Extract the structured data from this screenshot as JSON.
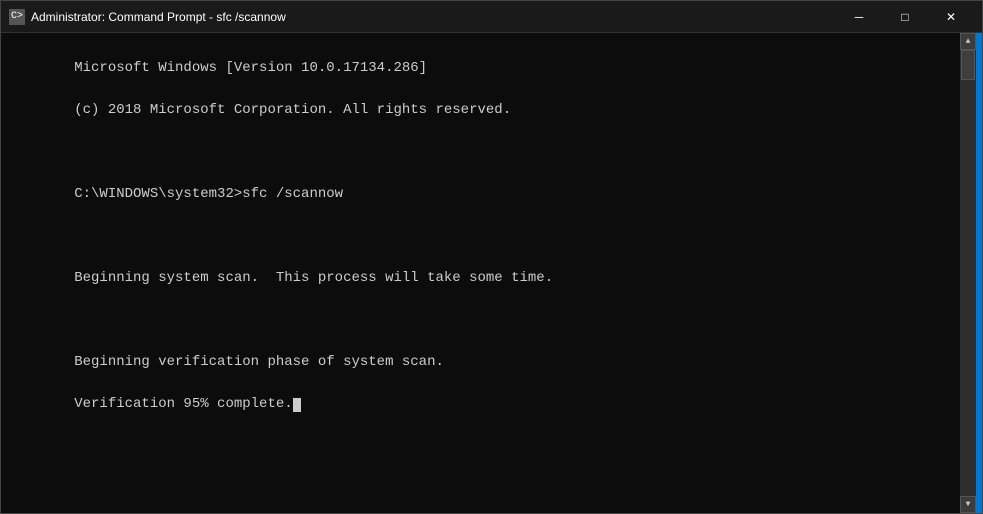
{
  "titlebar": {
    "icon_label": "C>",
    "title": "Administrator: Command Prompt - sfc /scannow",
    "minimize_label": "─",
    "maximize_label": "□",
    "close_label": "✕"
  },
  "terminal": {
    "line1": "Microsoft Windows [Version 10.0.17134.286]",
    "line2": "(c) 2018 Microsoft Corporation. All rights reserved.",
    "line3": "",
    "line4": "C:\\WINDOWS\\system32>sfc /scannow",
    "line5": "",
    "line6": "Beginning system scan.  This process will take some time.",
    "line7": "",
    "line8": "Beginning verification phase of system scan.",
    "line9_prefix": "Verification 95% complete."
  }
}
